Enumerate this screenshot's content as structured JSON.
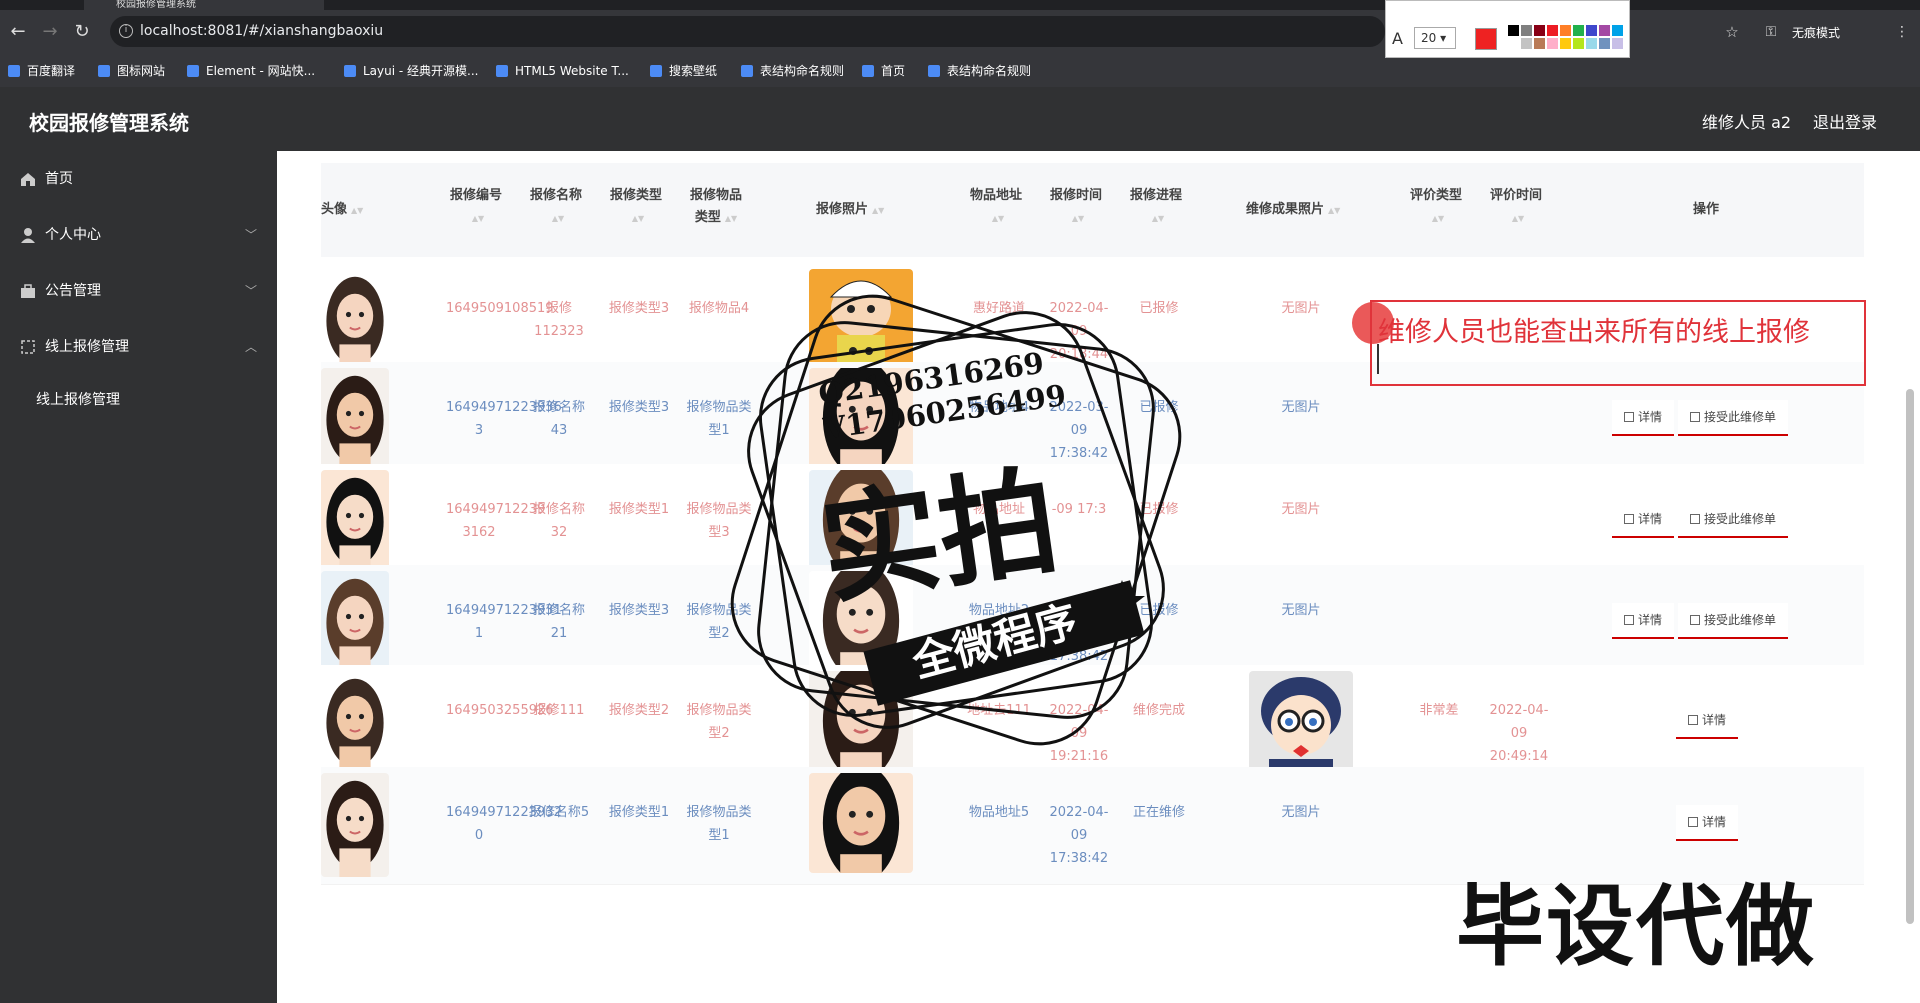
{
  "browser": {
    "tab_title": "校园报修管理系统",
    "url": "localhost:8081/#/xianshangbaoxiu",
    "incognito_label": "无痕模式",
    "bookmarks": [
      "百度翻译",
      "图标网站",
      "Element - 网站快...",
      "Layui - 经典开源模...",
      "HTML5 Website T...",
      "搜索壁纸",
      "表结构命名规则",
      "首页",
      "表结构命名规则"
    ],
    "annot_font_size": "20",
    "annot_colors": [
      "#000000",
      "#7f7f7f",
      "#880015",
      "#ed1c24",
      "#ff7f27",
      "#22b14c",
      "#3f48cc",
      "#a349a4",
      "#00a2e8",
      "#ffffff",
      "#c3c3c3",
      "#b97a57",
      "#ffaec9",
      "#ffc90e",
      "#b5e61d",
      "#99d9ea",
      "#7092be",
      "#c8bfe7"
    ]
  },
  "header": {
    "title": "校园报修管理系统",
    "user": "维修人员 a2",
    "logout": "退出登录"
  },
  "sidebar": {
    "items": [
      {
        "label": "首页",
        "icon": "home-icon"
      },
      {
        "label": "个人中心",
        "icon": "user-icon"
      },
      {
        "label": "公告管理",
        "icon": "briefcase-icon"
      },
      {
        "label": "线上报修管理",
        "icon": "crop-icon"
      }
    ],
    "sub_item": "线上报修管理"
  },
  "table": {
    "headers": {
      "avatar": "头像",
      "code": "报修编号",
      "name": "报修名称",
      "type": "报修类型",
      "item_type_1": "报修物品",
      "item_type_2": "类型",
      "photo": "报修照片",
      "address": "物品地址",
      "time": "报修时间",
      "progress": "报修进程",
      "result_photo": "维修成果照片",
      "eval_type": "评价类型",
      "eval_time": "评价时间",
      "ops": "操作"
    },
    "rows": [
      {
        "code": "1649509108519",
        "name": "报修112323",
        "type": "报修类型3",
        "item_type": "报修物品4",
        "address": "惠好路道",
        "time": "2022-04-09 20:18:44",
        "progress": "已报修",
        "result": "无图片",
        "eval_type": "",
        "eval_time": "",
        "ops": []
      },
      {
        "code": "16494971223936 3",
        "name": "报修名称43",
        "type": "报修类型3",
        "item_type": "报修物品类型1",
        "address": "物品地址4",
        "time": "2022-03-09 17:38:42",
        "progress": "已报修",
        "result": "无图片",
        "eval_type": "",
        "eval_time": "",
        "ops": [
          "详情",
          "接受此维修单"
        ]
      },
      {
        "code": "164949712239 3162",
        "name": "报修名称32",
        "type": "报修类型1",
        "item_type": "报修物品类型3",
        "address": "物品地址",
        "time": "-09 17:3",
        "progress": "已报修",
        "result": "无图片",
        "eval_type": "",
        "eval_time": "",
        "ops": [
          "详情",
          "接受此维修单"
        ]
      },
      {
        "code": "16494971223931 1",
        "name": "报修名称21",
        "type": "报修类型3",
        "item_type": "报修物品类型2",
        "address": "物品地址2",
        "time": "2022-03-09 17:38:42",
        "progress": "已报修",
        "result": "无图片",
        "eval_type": "",
        "eval_time": "",
        "ops": [
          "详情",
          "接受此维修单"
        ]
      },
      {
        "code": "1649503255926",
        "name": "报修111",
        "type": "报修类型2",
        "item_type": "报修物品类型2",
        "address": "地址去111",
        "time": "2022-04-09 19:21:16",
        "progress": "维修完成",
        "result": "",
        "eval_type": "非常差",
        "eval_time": "2022-04-09 20:49:14",
        "ops": [
          "详情"
        ]
      },
      {
        "code": "16494971223932 0",
        "name": "报修名称5",
        "type": "报修类型1",
        "item_type": "报修物品类型1",
        "address": "物品地址5",
        "time": "2022-04-09 17:38:42",
        "progress": "正在维修",
        "result": "无图片",
        "eval_type": "",
        "eval_time": "",
        "ops": [
          "详情"
        ]
      }
    ]
  },
  "annotation": {
    "text": "维修人员也能查出来所有的线上报修",
    "color": "#e0333a"
  },
  "watermark": {
    "qq": "Q2196316269",
    "vx": "V17060256499",
    "big": "实拍",
    "band": "全微程序",
    "corner": "毕设代做"
  }
}
